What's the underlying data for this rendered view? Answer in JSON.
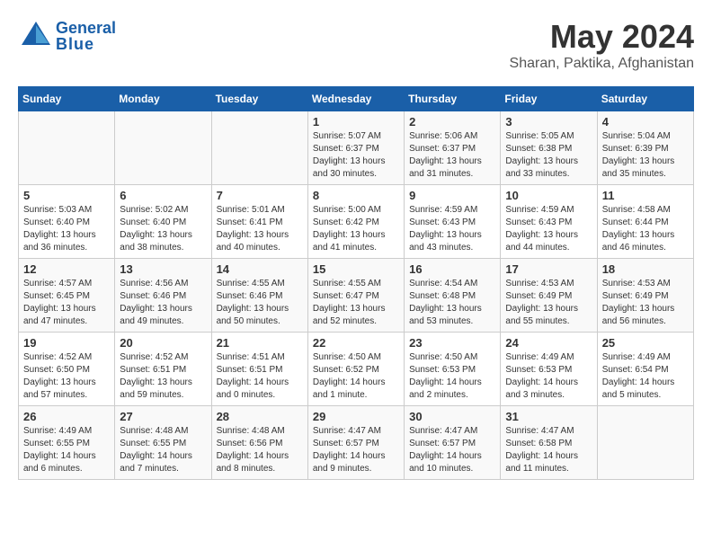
{
  "header": {
    "logo_general": "General",
    "logo_blue": "Blue",
    "month_year": "May 2024",
    "location": "Sharan, Paktika, Afghanistan"
  },
  "days_of_week": [
    "Sunday",
    "Monday",
    "Tuesday",
    "Wednesday",
    "Thursday",
    "Friday",
    "Saturday"
  ],
  "weeks": [
    [
      {
        "day": "",
        "sunrise": "",
        "sunset": "",
        "daylight": ""
      },
      {
        "day": "",
        "sunrise": "",
        "sunset": "",
        "daylight": ""
      },
      {
        "day": "",
        "sunrise": "",
        "sunset": "",
        "daylight": ""
      },
      {
        "day": "1",
        "sunrise": "Sunrise: 5:07 AM",
        "sunset": "Sunset: 6:37 PM",
        "daylight": "Daylight: 13 hours and 30 minutes."
      },
      {
        "day": "2",
        "sunrise": "Sunrise: 5:06 AM",
        "sunset": "Sunset: 6:37 PM",
        "daylight": "Daylight: 13 hours and 31 minutes."
      },
      {
        "day": "3",
        "sunrise": "Sunrise: 5:05 AM",
        "sunset": "Sunset: 6:38 PM",
        "daylight": "Daylight: 13 hours and 33 minutes."
      },
      {
        "day": "4",
        "sunrise": "Sunrise: 5:04 AM",
        "sunset": "Sunset: 6:39 PM",
        "daylight": "Daylight: 13 hours and 35 minutes."
      }
    ],
    [
      {
        "day": "5",
        "sunrise": "Sunrise: 5:03 AM",
        "sunset": "Sunset: 6:40 PM",
        "daylight": "Daylight: 13 hours and 36 minutes."
      },
      {
        "day": "6",
        "sunrise": "Sunrise: 5:02 AM",
        "sunset": "Sunset: 6:40 PM",
        "daylight": "Daylight: 13 hours and 38 minutes."
      },
      {
        "day": "7",
        "sunrise": "Sunrise: 5:01 AM",
        "sunset": "Sunset: 6:41 PM",
        "daylight": "Daylight: 13 hours and 40 minutes."
      },
      {
        "day": "8",
        "sunrise": "Sunrise: 5:00 AM",
        "sunset": "Sunset: 6:42 PM",
        "daylight": "Daylight: 13 hours and 41 minutes."
      },
      {
        "day": "9",
        "sunrise": "Sunrise: 4:59 AM",
        "sunset": "Sunset: 6:43 PM",
        "daylight": "Daylight: 13 hours and 43 minutes."
      },
      {
        "day": "10",
        "sunrise": "Sunrise: 4:59 AM",
        "sunset": "Sunset: 6:43 PM",
        "daylight": "Daylight: 13 hours and 44 minutes."
      },
      {
        "day": "11",
        "sunrise": "Sunrise: 4:58 AM",
        "sunset": "Sunset: 6:44 PM",
        "daylight": "Daylight: 13 hours and 46 minutes."
      }
    ],
    [
      {
        "day": "12",
        "sunrise": "Sunrise: 4:57 AM",
        "sunset": "Sunset: 6:45 PM",
        "daylight": "Daylight: 13 hours and 47 minutes."
      },
      {
        "day": "13",
        "sunrise": "Sunrise: 4:56 AM",
        "sunset": "Sunset: 6:46 PM",
        "daylight": "Daylight: 13 hours and 49 minutes."
      },
      {
        "day": "14",
        "sunrise": "Sunrise: 4:55 AM",
        "sunset": "Sunset: 6:46 PM",
        "daylight": "Daylight: 13 hours and 50 minutes."
      },
      {
        "day": "15",
        "sunrise": "Sunrise: 4:55 AM",
        "sunset": "Sunset: 6:47 PM",
        "daylight": "Daylight: 13 hours and 52 minutes."
      },
      {
        "day": "16",
        "sunrise": "Sunrise: 4:54 AM",
        "sunset": "Sunset: 6:48 PM",
        "daylight": "Daylight: 13 hours and 53 minutes."
      },
      {
        "day": "17",
        "sunrise": "Sunrise: 4:53 AM",
        "sunset": "Sunset: 6:49 PM",
        "daylight": "Daylight: 13 hours and 55 minutes."
      },
      {
        "day": "18",
        "sunrise": "Sunrise: 4:53 AM",
        "sunset": "Sunset: 6:49 PM",
        "daylight": "Daylight: 13 hours and 56 minutes."
      }
    ],
    [
      {
        "day": "19",
        "sunrise": "Sunrise: 4:52 AM",
        "sunset": "Sunset: 6:50 PM",
        "daylight": "Daylight: 13 hours and 57 minutes."
      },
      {
        "day": "20",
        "sunrise": "Sunrise: 4:52 AM",
        "sunset": "Sunset: 6:51 PM",
        "daylight": "Daylight: 13 hours and 59 minutes."
      },
      {
        "day": "21",
        "sunrise": "Sunrise: 4:51 AM",
        "sunset": "Sunset: 6:51 PM",
        "daylight": "Daylight: 14 hours and 0 minutes."
      },
      {
        "day": "22",
        "sunrise": "Sunrise: 4:50 AM",
        "sunset": "Sunset: 6:52 PM",
        "daylight": "Daylight: 14 hours and 1 minute."
      },
      {
        "day": "23",
        "sunrise": "Sunrise: 4:50 AM",
        "sunset": "Sunset: 6:53 PM",
        "daylight": "Daylight: 14 hours and 2 minutes."
      },
      {
        "day": "24",
        "sunrise": "Sunrise: 4:49 AM",
        "sunset": "Sunset: 6:53 PM",
        "daylight": "Daylight: 14 hours and 3 minutes."
      },
      {
        "day": "25",
        "sunrise": "Sunrise: 4:49 AM",
        "sunset": "Sunset: 6:54 PM",
        "daylight": "Daylight: 14 hours and 5 minutes."
      }
    ],
    [
      {
        "day": "26",
        "sunrise": "Sunrise: 4:49 AM",
        "sunset": "Sunset: 6:55 PM",
        "daylight": "Daylight: 14 hours and 6 minutes."
      },
      {
        "day": "27",
        "sunrise": "Sunrise: 4:48 AM",
        "sunset": "Sunset: 6:55 PM",
        "daylight": "Daylight: 14 hours and 7 minutes."
      },
      {
        "day": "28",
        "sunrise": "Sunrise: 4:48 AM",
        "sunset": "Sunset: 6:56 PM",
        "daylight": "Daylight: 14 hours and 8 minutes."
      },
      {
        "day": "29",
        "sunrise": "Sunrise: 4:47 AM",
        "sunset": "Sunset: 6:57 PM",
        "daylight": "Daylight: 14 hours and 9 minutes."
      },
      {
        "day": "30",
        "sunrise": "Sunrise: 4:47 AM",
        "sunset": "Sunset: 6:57 PM",
        "daylight": "Daylight: 14 hours and 10 minutes."
      },
      {
        "day": "31",
        "sunrise": "Sunrise: 4:47 AM",
        "sunset": "Sunset: 6:58 PM",
        "daylight": "Daylight: 14 hours and 11 minutes."
      },
      {
        "day": "",
        "sunrise": "",
        "sunset": "",
        "daylight": ""
      }
    ]
  ]
}
